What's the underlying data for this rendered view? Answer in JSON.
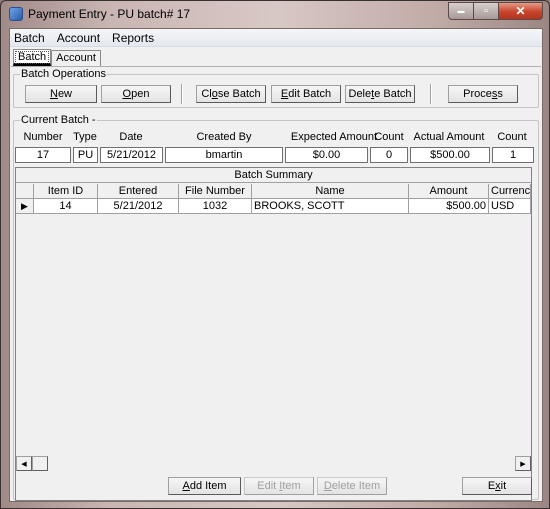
{
  "window": {
    "title": "Payment Entry - PU batch# 17",
    "minimize_icon": "minimize-icon",
    "maximize_icon": "maximize-icon",
    "close_icon": "close-icon",
    "close_glyph": "✕",
    "minimize_glyph": "▬",
    "maximize_glyph": "▫"
  },
  "menu": [
    "Batch",
    "Account",
    "Reports"
  ],
  "tabs": [
    {
      "label": "Batch",
      "active": true
    },
    {
      "label": "Account",
      "active": false
    }
  ],
  "batch_operations": {
    "label": "Batch Operations",
    "buttons": [
      {
        "pre": "",
        "u": "N",
        "post": "ew"
      },
      {
        "pre": "",
        "u": "O",
        "post": "pen"
      },
      {
        "pre": "Cl",
        "u": "o",
        "post": "se Batch"
      },
      {
        "pre": "",
        "u": "E",
        "post": "dit Batch"
      },
      {
        "pre": "Dele",
        "u": "t",
        "post": "e Batch"
      },
      {
        "pre": "Proce",
        "u": "s",
        "post": "s"
      }
    ]
  },
  "current_batch": {
    "label": "Current Batch -",
    "headers": [
      "Number",
      "Type",
      "Date",
      "Created By",
      "Expected Amount",
      "Count",
      "Actual Amount",
      "Count"
    ],
    "values": [
      "17",
      "PU",
      "5/21/2012",
      "bmartin",
      "$0.00",
      "0",
      "$500.00",
      "1"
    ]
  },
  "batch_summary": {
    "caption": "Batch Summary",
    "columns": [
      "",
      "Item ID",
      "Entered",
      "File Number",
      "Name",
      "Amount",
      "Currency"
    ],
    "rows": [
      {
        "selected": true,
        "indicator": "▶",
        "item_id": "14",
        "entered": "5/21/2012",
        "file_number": "1032",
        "name": "BROOKS, SCOTT",
        "amount": "$500.00",
        "currency": "USD"
      }
    ],
    "scroll_left": "◀",
    "scroll_right": "▶"
  },
  "bottom_buttons": [
    {
      "pre": "",
      "u": "A",
      "post": "dd Item",
      "enabled": true
    },
    {
      "pre": "Edit ",
      "u": "I",
      "post": "tem",
      "enabled": false
    },
    {
      "pre": "",
      "u": "D",
      "post": "elete Item",
      "enabled": false
    },
    {
      "pre": "E",
      "u": "x",
      "post": "it",
      "enabled": true
    }
  ]
}
